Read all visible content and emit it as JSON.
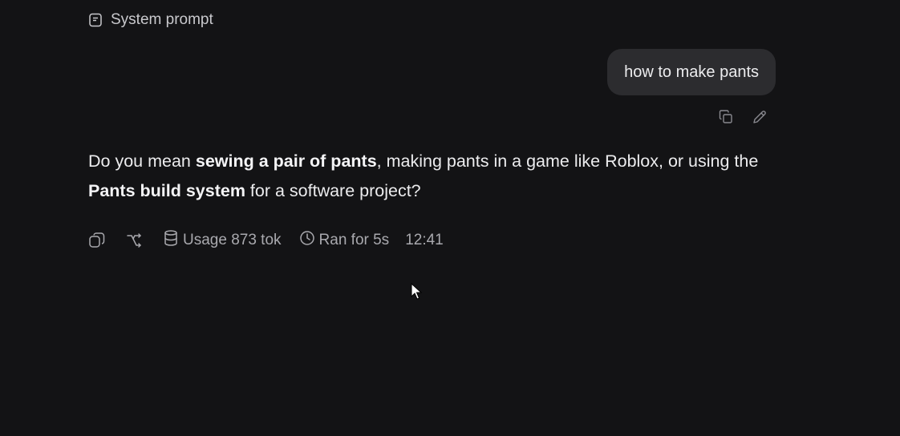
{
  "system_prompt": {
    "label": "System prompt",
    "icon": "document-icon"
  },
  "user_message": {
    "text": "how to make pants"
  },
  "user_actions": {
    "copy_icon": "copy-icon",
    "edit_icon": "pencil-icon"
  },
  "assistant_message": {
    "segments": [
      {
        "text": "Do you mean ",
        "bold": false
      },
      {
        "text": "sewing a pair of pants",
        "bold": true
      },
      {
        "text": ", making pants in a game like Roblox, or using the ",
        "bold": false
      },
      {
        "text": "Pants build system",
        "bold": true
      },
      {
        "text": " for a software project?",
        "bold": false
      }
    ]
  },
  "meta": {
    "usage_label": "Usage 873 tok",
    "ran_for_label": "Ran for 5s",
    "time": "12:41",
    "icons": [
      "copy-icon",
      "branch-icon",
      "database-icon",
      "clock-icon"
    ]
  },
  "colors": {
    "background": "#131315",
    "bubble": "#2c2c2f",
    "text": "#ececee",
    "muted": "#a9a9ae"
  }
}
